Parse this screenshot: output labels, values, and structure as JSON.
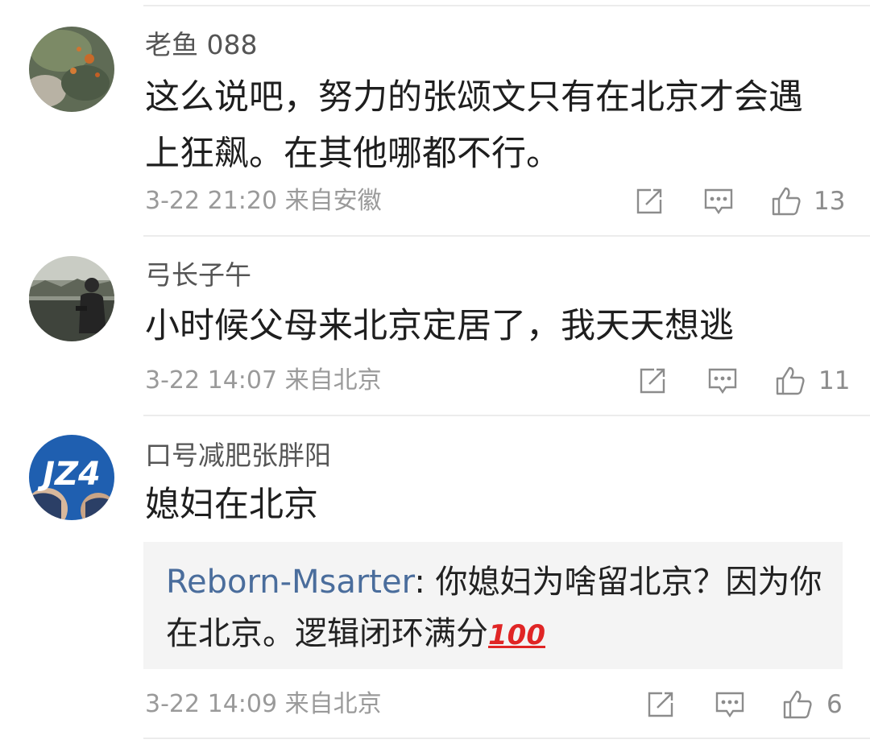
{
  "comments": [
    {
      "username": "老鱼 088",
      "text": "这么说吧，努力的张颂文只有在北京才会遇上狂飙。在其他哪都不行。",
      "time": "3-22 21:20",
      "location": "来自安徽",
      "likes": "13"
    },
    {
      "username": "弓长子午",
      "text": "小时候父母来北京定居了，我天天想逃",
      "time": "3-22 14:07",
      "location": "来自北京",
      "likes": "11"
    },
    {
      "username": "口号减肥张胖阳",
      "text": "媳妇在北京",
      "time": "3-22 14:09",
      "location": "来自北京",
      "likes": "6",
      "avatar_text": "JZ4",
      "reply": {
        "user": "Reborn-Msarter",
        "separator": ": ",
        "text": "你媳妇为啥留北京？因为你在北京。逻辑闭环满分",
        "emoji": "100"
      }
    }
  ],
  "icons": {
    "share": "share-icon",
    "comment": "comment-icon",
    "like": "thumbs-up-icon"
  },
  "colors": {
    "reply_user": "#4a6d9c",
    "meta": "#9a9a9a",
    "reply_bg": "#f4f4f4"
  }
}
